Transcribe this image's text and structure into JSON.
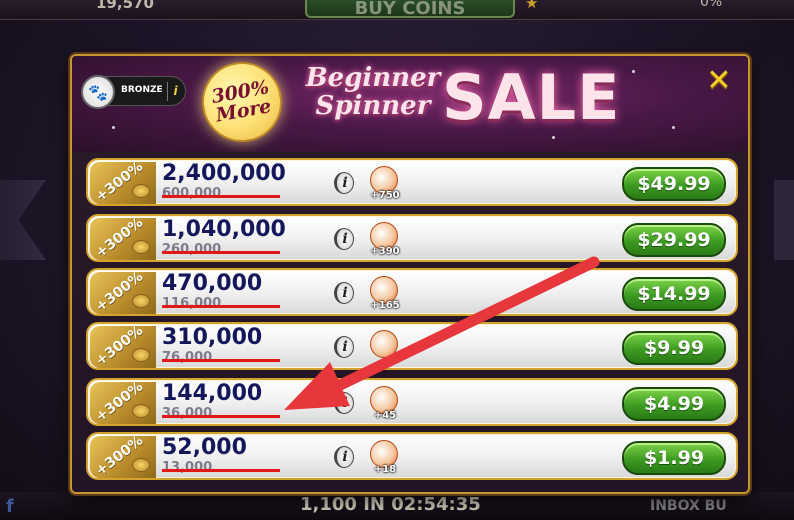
{
  "background": {
    "top_coins": "19,570",
    "buy_coins_label": "BUY COINS",
    "top_right": "0%",
    "bottom_timer": "1,100 IN 02:54:35",
    "bottom_left": "f",
    "bottom_right": "INBOX   BU"
  },
  "header": {
    "tier_label": "BRONZE",
    "tier_info": "i",
    "badge_line1": "300%",
    "badge_line2": "More",
    "title_line1": "Beginner",
    "title_line2": "Spinner",
    "title_sale": "SALE",
    "close": "✕"
  },
  "packages": [
    {
      "bonus": "+300%",
      "amount": "2,400,000",
      "old_amount": "600,000",
      "info": "i",
      "pet_bonus": "+750",
      "price": "$49.99"
    },
    {
      "bonus": "+300%",
      "amount": "1,040,000",
      "old_amount": "260,000",
      "info": "i",
      "pet_bonus": "+390",
      "price": "$29.99"
    },
    {
      "bonus": "+300%",
      "amount": "470,000",
      "old_amount": "116,000",
      "info": "i",
      "pet_bonus": "+165",
      "price": "$14.99"
    },
    {
      "bonus": "+300%",
      "amount": "310,000",
      "old_amount": "76,000",
      "info": "i",
      "pet_bonus": "",
      "price": "$9.99"
    },
    {
      "bonus": "+300%",
      "amount": "144,000",
      "old_amount": "36,000",
      "info": "i",
      "pet_bonus": "+45",
      "price": "$4.99"
    },
    {
      "bonus": "+300%",
      "amount": "52,000",
      "old_amount": "13,000",
      "info": "i",
      "pet_bonus": "+18",
      "price": "$1.99"
    }
  ],
  "colors": {
    "frame_gold": "#c8962e",
    "amount_navy": "#14175c",
    "strike_red": "#e01818",
    "price_green": "#3d9b22",
    "annotation_arrow": "#e8363d"
  },
  "icons": {
    "close": "close-icon",
    "info": "info-icon",
    "pet": "pet-icon",
    "coin": "coin-icon"
  }
}
